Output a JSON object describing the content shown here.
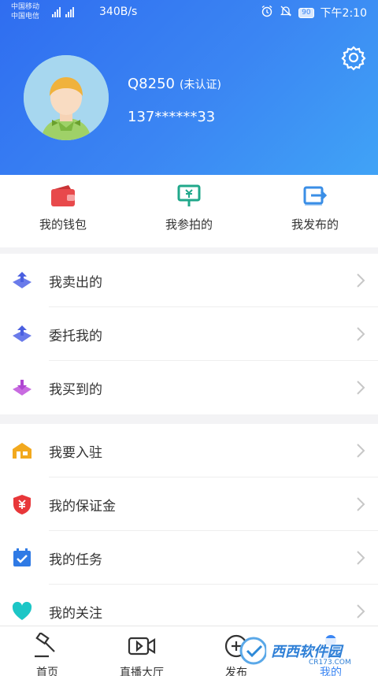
{
  "status_bar": {
    "carrier_1": "中国移动",
    "carrier_2": "中国电信",
    "net_speed": "340B/s",
    "battery": "90",
    "time": "下午2:10"
  },
  "profile": {
    "username": "Q8250",
    "verify_status": "(未认证)",
    "phone": "137******33"
  },
  "quick_actions": [
    {
      "label": "我的钱包",
      "icon": "wallet-icon",
      "color": "#e8494b"
    },
    {
      "label": "我参拍的",
      "icon": "auction-screen-icon",
      "color": "#21a88b"
    },
    {
      "label": "我发布的",
      "icon": "publish-icon",
      "color": "#3a8ee6"
    }
  ],
  "menu_group_1": [
    {
      "label": "我卖出的",
      "icon": "upload-tray-icon"
    },
    {
      "label": "委托我的",
      "icon": "upload-tray-icon"
    },
    {
      "label": "我买到的",
      "icon": "download-tray-icon"
    }
  ],
  "menu_group_2": [
    {
      "label": "我要入驻",
      "icon": "shop-icon"
    },
    {
      "label": "我的保证金",
      "icon": "deposit-shield-icon"
    },
    {
      "label": "我的任务",
      "icon": "calendar-check-icon"
    },
    {
      "label": "我的关注",
      "icon": "heart-icon"
    }
  ],
  "bottom_nav": [
    {
      "label": "首页",
      "icon": "gavel-icon"
    },
    {
      "label": "直播大厅",
      "icon": "video-camera-icon"
    },
    {
      "label": "发布",
      "icon": "publish-icon"
    },
    {
      "label": "我的",
      "icon": "user-icon"
    }
  ],
  "watermark": {
    "text": "西西软件园",
    "subtext": "CR173.COM"
  },
  "colors": {
    "header_start": "#2f6df0",
    "header_end": "#40a3f6",
    "accent": "#3b86f3"
  }
}
